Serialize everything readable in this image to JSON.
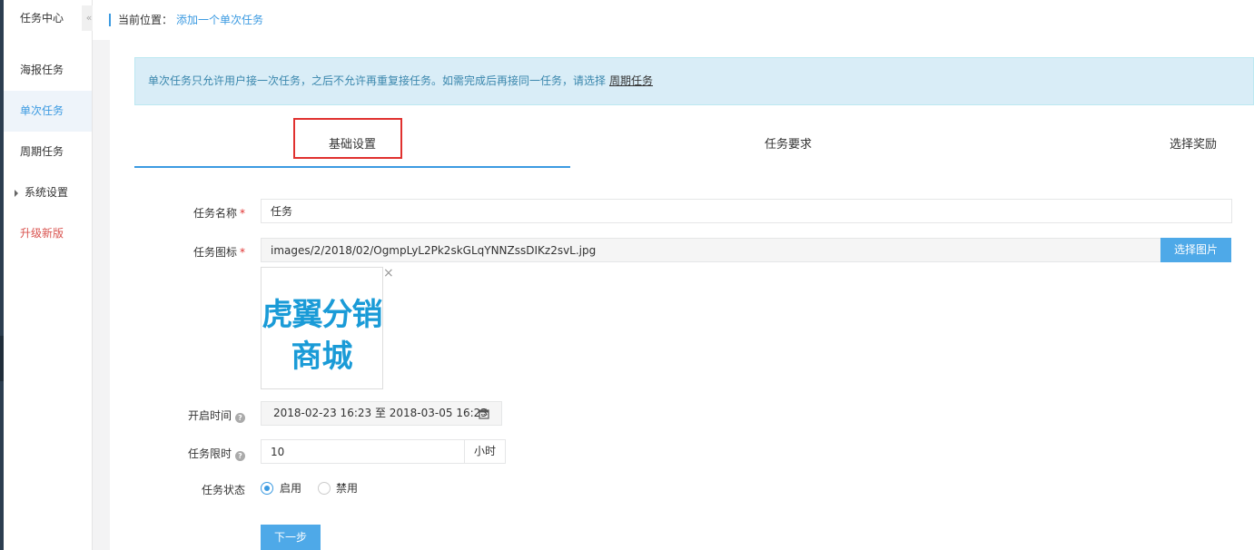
{
  "sidebar": {
    "title": "任务中心",
    "collapse_icon": "«",
    "items": [
      {
        "label": "海报任务"
      },
      {
        "label": "单次任务"
      },
      {
        "label": "周期任务"
      },
      {
        "label": "系统设置"
      },
      {
        "label": "升级新版"
      }
    ]
  },
  "breadcrumb": {
    "current_label": "当前位置：",
    "link": "添加一个单次任务"
  },
  "alert": {
    "text": "单次任务只允许用户接一次任务，之后不允许再重复接任务。如需完成后再接同一任务，请选择",
    "link": "周期任务"
  },
  "steps": [
    {
      "label": "基础设置"
    },
    {
      "label": "任务要求"
    },
    {
      "label": "选择奖励"
    }
  ],
  "form": {
    "name": {
      "label": "任务名称",
      "value": "任务"
    },
    "icon": {
      "label": "任务图标",
      "value": "images/2/2018/02/OgmpLyL2Pk2skGLqYNNZssDIKz2svL.jpg",
      "button": "选择图片",
      "close": "×"
    },
    "logo": {
      "line1": "虎翼分销",
      "line2_a": "商",
      "line2_b": "城"
    },
    "time": {
      "label": "开启时间",
      "value": "2018-02-23 16:23 至 2018-03-05 16:23"
    },
    "limit": {
      "label": "任务限时",
      "value": "10",
      "unit": "小时"
    },
    "status": {
      "label": "任务状态",
      "on": "启用",
      "off": "禁用"
    },
    "next": "下一步"
  },
  "colors": {
    "accent": "#3b9ae1",
    "highlight_box": "#e0312f",
    "alert_bg": "#d9edf7"
  }
}
